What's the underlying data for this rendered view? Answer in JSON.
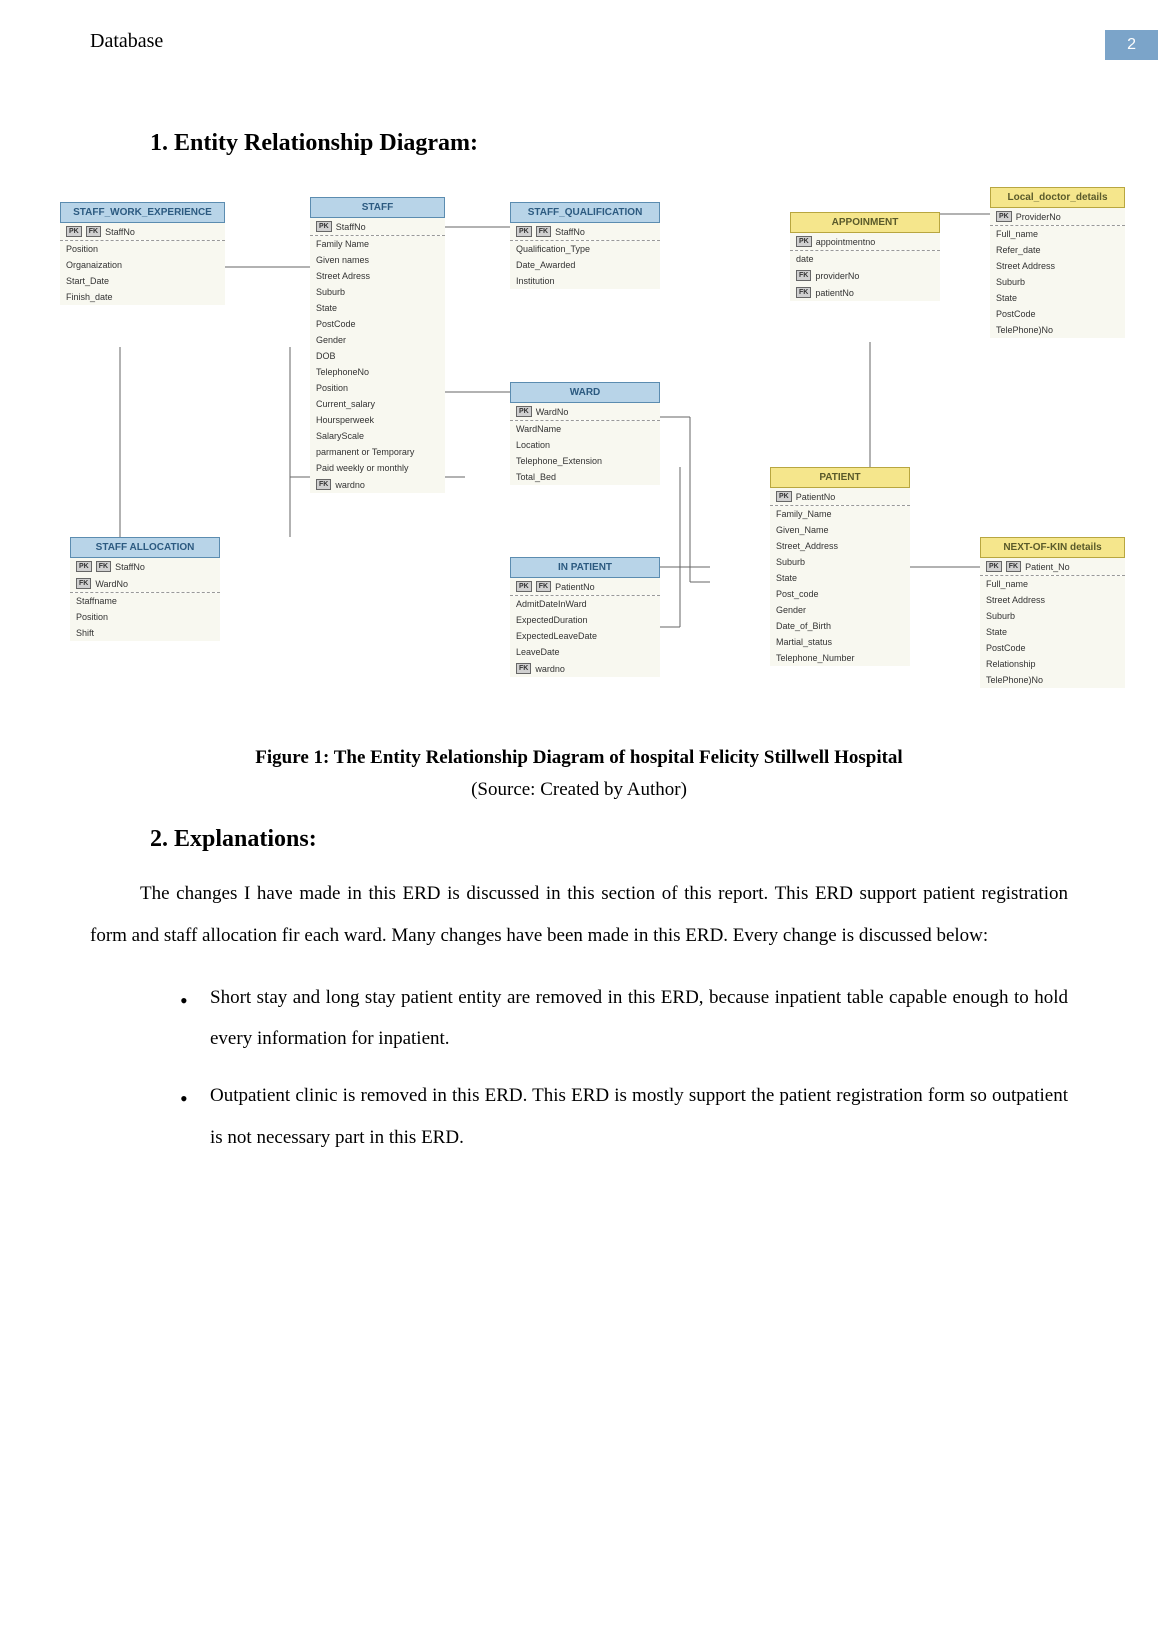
{
  "header": {
    "left": "Database",
    "right": "2"
  },
  "section1_title": "1. Entity Relationship Diagram:",
  "figure_caption": "Figure 1: The Entity Relationship Diagram of hospital Felicity Stillwell Hospital",
  "source_caption": "(Source: Created by Author)",
  "section2_title": "2. Explanations:",
  "para1": "The changes I have made in this ERD is discussed in this section of this report. This ERD support patient registration form and staff allocation fir each ward. Many changes have been made in this ERD. Every change is discussed below:",
  "bullet1": "Short stay and long stay patient entity are removed in this ERD, because inpatient table capable enough to hold every information for inpatient.",
  "bullet2": "Outpatient clinic is removed in this ERD. This ERD is mostly support the patient registration form so outpatient is not necessary part in this ERD.",
  "entities": {
    "staff_work_experience": {
      "title": "STAFF_WORK_EXPERIENCE",
      "rows": [
        "StaffNo",
        "Position",
        "Organaization",
        "Start_Date",
        "Finish_date"
      ]
    },
    "staff": {
      "title": "STAFF",
      "rows": [
        "StaffNo",
        "Family Name",
        "Given names",
        "Street Adress",
        "Suburb",
        "State",
        "PostCode",
        "Gender",
        "DOB",
        "TelephoneNo",
        "Position",
        "Current_salary",
        "Hoursperweek",
        "SalaryScale",
        "parmanent or Temporary",
        "Paid weekly or monthly",
        "wardno"
      ]
    },
    "staff_qualification": {
      "title": "STAFF_QUALIFICATION",
      "rows": [
        "StaffNo",
        "Qualification_Type",
        "Date_Awarded",
        "Institution"
      ]
    },
    "ward": {
      "title": "WARD",
      "rows": [
        "WardNo",
        "WardName",
        "Location",
        "Telephone_Extension",
        "Total_Bed"
      ]
    },
    "staff_allocation": {
      "title": "STAFF ALLOCATION",
      "rows": [
        "StaffNo",
        "WardNo",
        "Staffname",
        "Position",
        "Shift"
      ]
    },
    "in_patient": {
      "title": "IN PATIENT",
      "rows": [
        "PatientNo",
        "AdmitDateInWard",
        "ExpectedDuration",
        "ExpectedLeaveDate",
        "LeaveDate",
        "wardno"
      ]
    },
    "appoinment": {
      "title": "APPOINMENT",
      "rows": [
        "appointmentno",
        "date",
        "providerNo",
        "patientNo"
      ]
    },
    "patient": {
      "title": "PATIENT",
      "rows": [
        "PatientNo",
        "Family_Name",
        "Given_Name",
        "Street_Address",
        "Suburb",
        "State",
        "Post_code",
        "Gender",
        "Date_of_Birth",
        "Martial_status",
        "Telephone_Number"
      ]
    },
    "local_doctor": {
      "title": "Local_doctor_details",
      "rows": [
        "ProviderNo",
        "Full_name",
        "Refer_date",
        "Street Address",
        "Suburb",
        "State",
        "PostCode",
        "TelePhone)No"
      ]
    },
    "next_of_kin": {
      "title": "NEXT-OF-KIN details",
      "rows": [
        "Patient_No",
        "Full_name",
        "Street Address",
        "Suburb",
        "State",
        "PostCode",
        "Relationship",
        "TelePhone)No"
      ]
    }
  },
  "key_labels": {
    "pk": "PK",
    "fk": "FK"
  }
}
